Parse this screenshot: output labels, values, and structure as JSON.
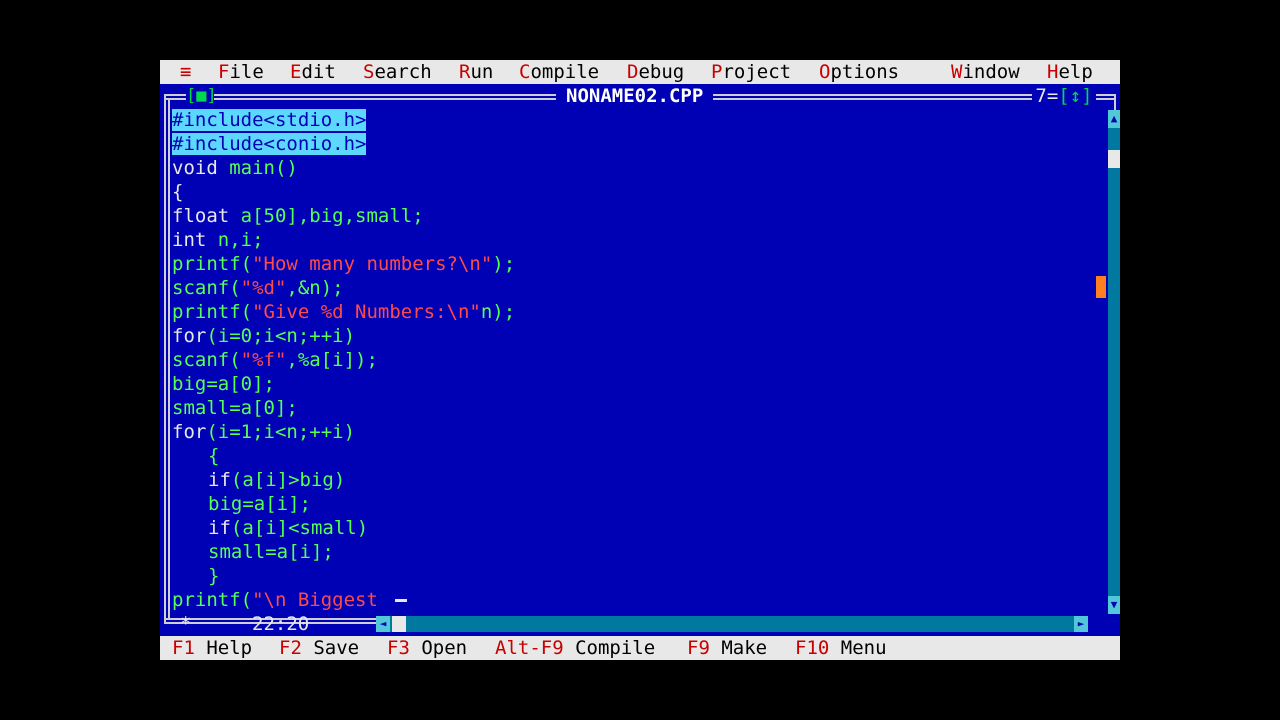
{
  "menu": [
    {
      "hot": "≡",
      "rest": ""
    },
    {
      "hot": "F",
      "rest": "ile"
    },
    {
      "hot": "E",
      "rest": "dit"
    },
    {
      "hot": "S",
      "rest": "earch"
    },
    {
      "hot": "R",
      "rest": "un"
    },
    {
      "hot": "C",
      "rest": "ompile"
    },
    {
      "hot": "D",
      "rest": "ebug"
    },
    {
      "hot": "P",
      "rest": "roject"
    },
    {
      "hot": "O",
      "rest": "ptions"
    },
    {
      "hot": "W",
      "rest": "indow"
    },
    {
      "hot": "H",
      "rest": "elp"
    }
  ],
  "window": {
    "close_box": "[■]",
    "title": "NONAME02.CPP",
    "number": "7",
    "zoom_box": "[↕]"
  },
  "code": {
    "l1": "#include<stdio.h>",
    "l2": "#include<conio.h>",
    "l3a": "void",
    "l3b": " main()",
    "l4": "{",
    "l5a": "float",
    "l5b": " a[50],big,small;",
    "l6a": "int",
    "l6b": " n,i;",
    "l7a": "printf(",
    "l7b": "\"How many numbers?\\n\"",
    "l7c": ");",
    "l8a": "scanf(",
    "l8b": "\"%d\"",
    "l8c": ",&n);",
    "l9a": "printf(",
    "l9b": "\"Give %d Numbers:\\n\"",
    "l9c": "n);",
    "l10a": "for",
    "l10b": "(i=0;i<n;++i)",
    "l11a": "scanf(",
    "l11b": "\"%f\"",
    "l11c": ",%a[i]);",
    "l12": "big=a[0];",
    "l13": "small=a[0];",
    "l14a": "for",
    "l14b": "(i=1;i<n;++i)",
    "l15": "{",
    "l16a": "if",
    "l16b": "(a[i]>big)",
    "l17": "big=a[i];",
    "l18a": "if",
    "l18b": "(a[i]<small)",
    "l19": "small=a[i];",
    "l20": "}",
    "l21a": "printf(",
    "l21b": "\"\\n Biggest "
  },
  "status": {
    "star": "*",
    "position": "22:20"
  },
  "fkeys": [
    {
      "key": "F1",
      "label": "Help"
    },
    {
      "key": "F2",
      "label": "Save"
    },
    {
      "key": "F3",
      "label": "Open"
    },
    {
      "key": "Alt-F9",
      "label": "Compile"
    },
    {
      "key": "F9",
      "label": "Make"
    },
    {
      "key": "F10",
      "label": "Menu"
    }
  ],
  "colors": {
    "desktop": "#0000b4",
    "menu_bg": "#e8e8e8",
    "hotkey": "#c80000",
    "string": "#ff4a4a",
    "selection": "#5cd8ff",
    "scrollbar": "#0078a0"
  }
}
